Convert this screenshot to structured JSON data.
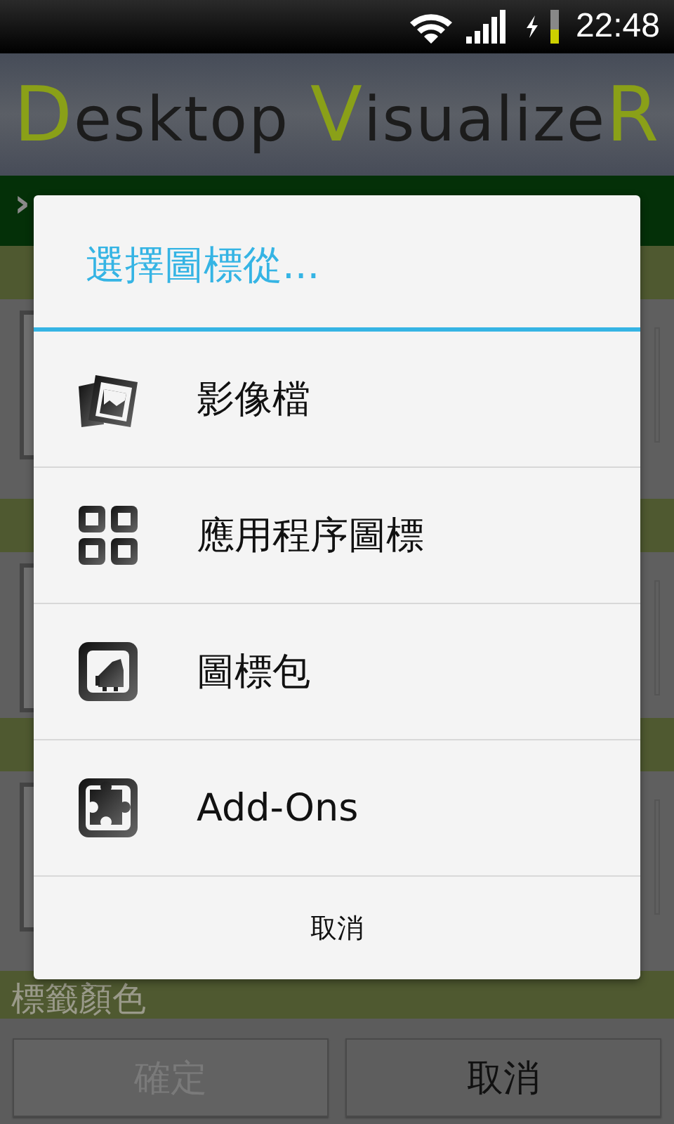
{
  "status_bar": {
    "time": "22:48"
  },
  "header": {
    "logo": [
      {
        "text": "D",
        "accent": true
      },
      {
        "text": "esktop ",
        "accent": false
      },
      {
        "text": "V",
        "accent": true
      },
      {
        "text": "isualize",
        "accent": false
      },
      {
        "text": "R",
        "accent": true
      }
    ]
  },
  "nav_bar": {
    "chevron": "›"
  },
  "sections": [
    {
      "title": "標籤顏色"
    }
  ],
  "dialog": {
    "title": "選擇圖標從...",
    "items": [
      {
        "kind": "image",
        "label": "影像檔"
      },
      {
        "kind": "apps",
        "label": "應用程序圖標"
      },
      {
        "kind": "pack",
        "label": "圖標包"
      },
      {
        "kind": "addon",
        "label": "Add-Ons"
      }
    ],
    "cancel": "取消"
  },
  "buttons": [
    {
      "label": "確定",
      "disabled": true
    },
    {
      "label": "取消",
      "disabled": false
    }
  ]
}
